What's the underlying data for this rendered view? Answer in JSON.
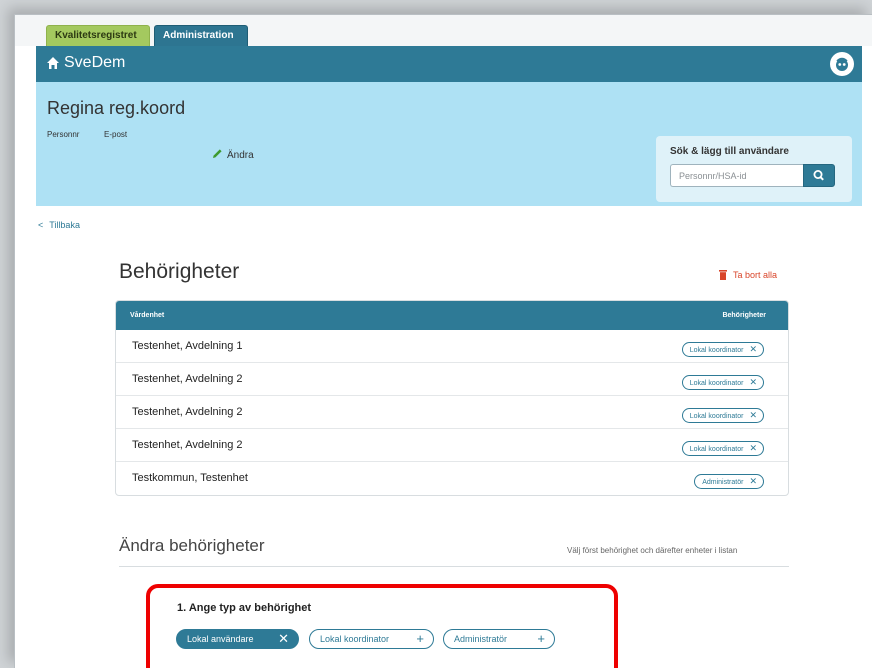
{
  "tabs": [
    {
      "label": "Kvalitetsregistret"
    },
    {
      "label": "Administration"
    }
  ],
  "header": {
    "brand": "SveDem"
  },
  "user": {
    "name": "Regina reg.koord",
    "personnr_label": "Personnr",
    "epost_label": "E-post",
    "edit_label": "Ändra"
  },
  "search": {
    "title": "Sök & lägg till användare",
    "placeholder": "Personnr/HSA-id"
  },
  "back_label": "Tillbaka",
  "permissions": {
    "heading": "Behörigheter",
    "remove_all_label": "Ta bort alla",
    "columns": [
      "Vårdenhet",
      "Behörigheter"
    ],
    "rows": [
      {
        "unit": "Testenhet, Avdelning 1",
        "role": "Lokal koordinator"
      },
      {
        "unit": "Testenhet, Avdelning 2",
        "role": "Lokal koordinator"
      },
      {
        "unit": "Testenhet, Avdelning 2",
        "role": "Lokal koordinator"
      },
      {
        "unit": "Testenhet, Avdelning 2",
        "role": "Lokal koordinator"
      },
      {
        "unit": "Testkommun, Testenhet",
        "role": "Administratör"
      }
    ]
  },
  "change": {
    "heading": "Ändra behörigheter",
    "hint": "Välj först behörighet och därefter enheter i listan",
    "step_title": "1. Ange typ av behörighet",
    "options": [
      {
        "label": "Lokal användare",
        "selected": true
      },
      {
        "label": "Lokal koordinator",
        "selected": false
      },
      {
        "label": "Administratör",
        "selected": false
      }
    ]
  },
  "colors": {
    "accent": "#2e7a96",
    "panel": "#aee1f4",
    "danger": "#d9452a",
    "highlight": "#ee0000",
    "tab_green": "#a4c95f"
  }
}
